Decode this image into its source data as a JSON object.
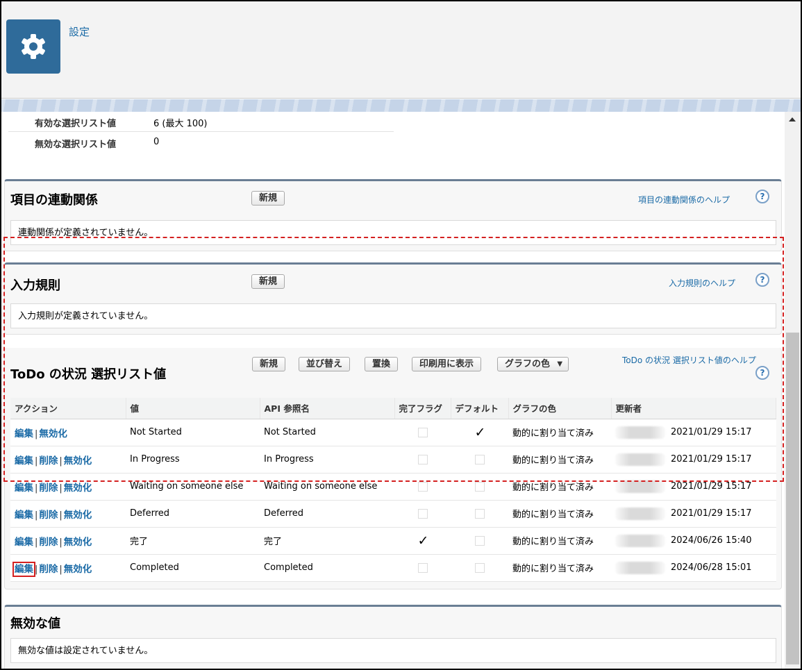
{
  "header": {
    "title": "設定",
    "icon": "gear-icon"
  },
  "summary": {
    "active_label": "有効な選択リスト値",
    "active_value": "6 (最大 100)",
    "inactive_label": "無効な選択リスト値",
    "inactive_value": "0"
  },
  "dependency": {
    "title": "項目の連動関係",
    "new_label": "新規",
    "help_label": "項目の連動関係のヘルプ",
    "message": "連動関係が定義されていません。"
  },
  "validation": {
    "title": "入力規則",
    "new_label": "新規",
    "help_label": "入力規則のヘルプ",
    "message": "入力規則が定義されていません。"
  },
  "picklist": {
    "title": "ToDo の状況 選択リスト値",
    "buttons": {
      "new": "新規",
      "sort": "並び替え",
      "replace": "置換",
      "print": "印刷用に表示",
      "chart_color": "グラフの色"
    },
    "help_label": "ToDo の状況 選択リスト値のヘルプ",
    "columns": [
      "アクション",
      "値",
      "API 参照名",
      "完了フラグ",
      "デフォルト",
      "グラフの色",
      "更新者"
    ],
    "actions": {
      "edit": "編集",
      "delete": "削除",
      "deactivate": "無効化"
    },
    "rows": [
      {
        "value": "Not Started",
        "api": "Not Started",
        "closed": false,
        "default": true,
        "color": "動的に割り当て済み",
        "modified": "2021/01/29 15:17"
      },
      {
        "value": "In Progress",
        "api": "In Progress",
        "closed": false,
        "default": false,
        "color": "動的に割り当て済み",
        "modified": "2021/01/29 15:17"
      },
      {
        "value": "Waiting on someone else",
        "api": "Waiting on someone else",
        "closed": false,
        "default": false,
        "color": "動的に割り当て済み",
        "modified": "2021/01/29 15:17"
      },
      {
        "value": "Deferred",
        "api": "Deferred",
        "closed": false,
        "default": false,
        "color": "動的に割り当て済み",
        "modified": "2021/01/29 15:17"
      },
      {
        "value": "完了",
        "api": "完了",
        "closed": true,
        "default": false,
        "color": "動的に割り当て済み",
        "modified": "2024/06/26 15:40"
      },
      {
        "value": "Completed",
        "api": "Completed",
        "closed": false,
        "default": false,
        "color": "動的に割り当て済み",
        "modified": "2024/06/28 15:01"
      }
    ]
  },
  "inactive": {
    "title": "無効な値",
    "message": "無効な値は設定されていません。"
  },
  "icons": {
    "help": "?",
    "check": "✓",
    "dropdown": "▼"
  }
}
